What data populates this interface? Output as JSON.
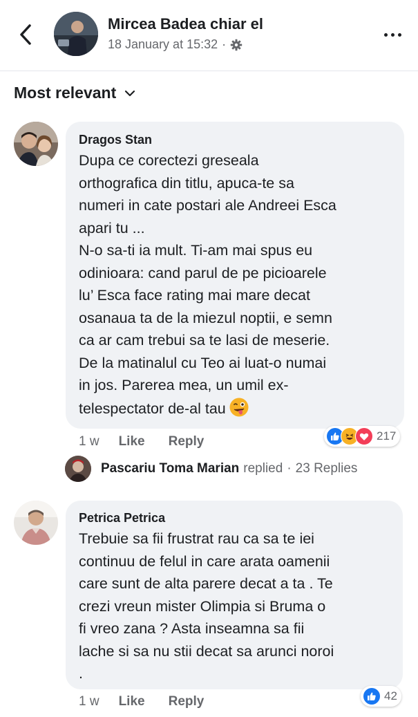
{
  "header": {
    "page_name": "Mircea Badea chiar el",
    "timestamp": "18 January at 15:32",
    "separator": "·",
    "icons": {
      "back": "chevron-left-icon",
      "privacy": "gear-icon",
      "more": "more-horizontal-icon"
    }
  },
  "sort": {
    "label": "Most relevant",
    "icon": "chevron-down-icon"
  },
  "comments": [
    {
      "author": "Dragos Stan",
      "text": "Dupa ce corectezi greseala\northografica din titlu, apuca-te sa\nnumeri in cate postari ale Andreei Esca\napari tu ...\nN-o sa-ti ia mult. Ti-am mai spus eu\nodinioara: cand parul de pe picioarele\nlu’ Esca face rating mai mare decat\nosanaua ta de la miezul noptii, e semn\nca ar cam trebui sa te lasi de meserie.\nDe la matinalul cu Teo ai luat-o numai\nin jos. Parerea mea, un umil ex-",
      "text_last_line": "telespectator de-al tau",
      "time": "1 w",
      "like_label": "Like",
      "reply_label": "Reply",
      "reaction_count": "217",
      "reactions": [
        "like",
        "haha",
        "love"
      ],
      "replies": {
        "name": "Pascariu Toma Marian",
        "verb": "replied",
        "separator": "·",
        "count_label": "23 Replies"
      }
    },
    {
      "author": "Petrica Petrica",
      "text": "Trebuie sa fii frustrat rau ca sa te iei\ncontinuu de felul in care arata oamenii\ncare sunt de alta parere decat a ta . Te\ncrezi vreun mister Olimpia si Bruma o\nfi vreo zana ? Asta inseamna sa fii\nlache si sa nu stii decat sa arunci noroi\n.",
      "time": "1 w",
      "like_label": "Like",
      "reply_label": "Reply",
      "reaction_count": "42",
      "reactions": [
        "like"
      ]
    }
  ],
  "colors": {
    "bubble": "#f0f2f5",
    "meta_text": "#65676b",
    "like_blue": "#1877f2",
    "love_red": "#f33e58",
    "haha_yellow": "#f7b125"
  }
}
